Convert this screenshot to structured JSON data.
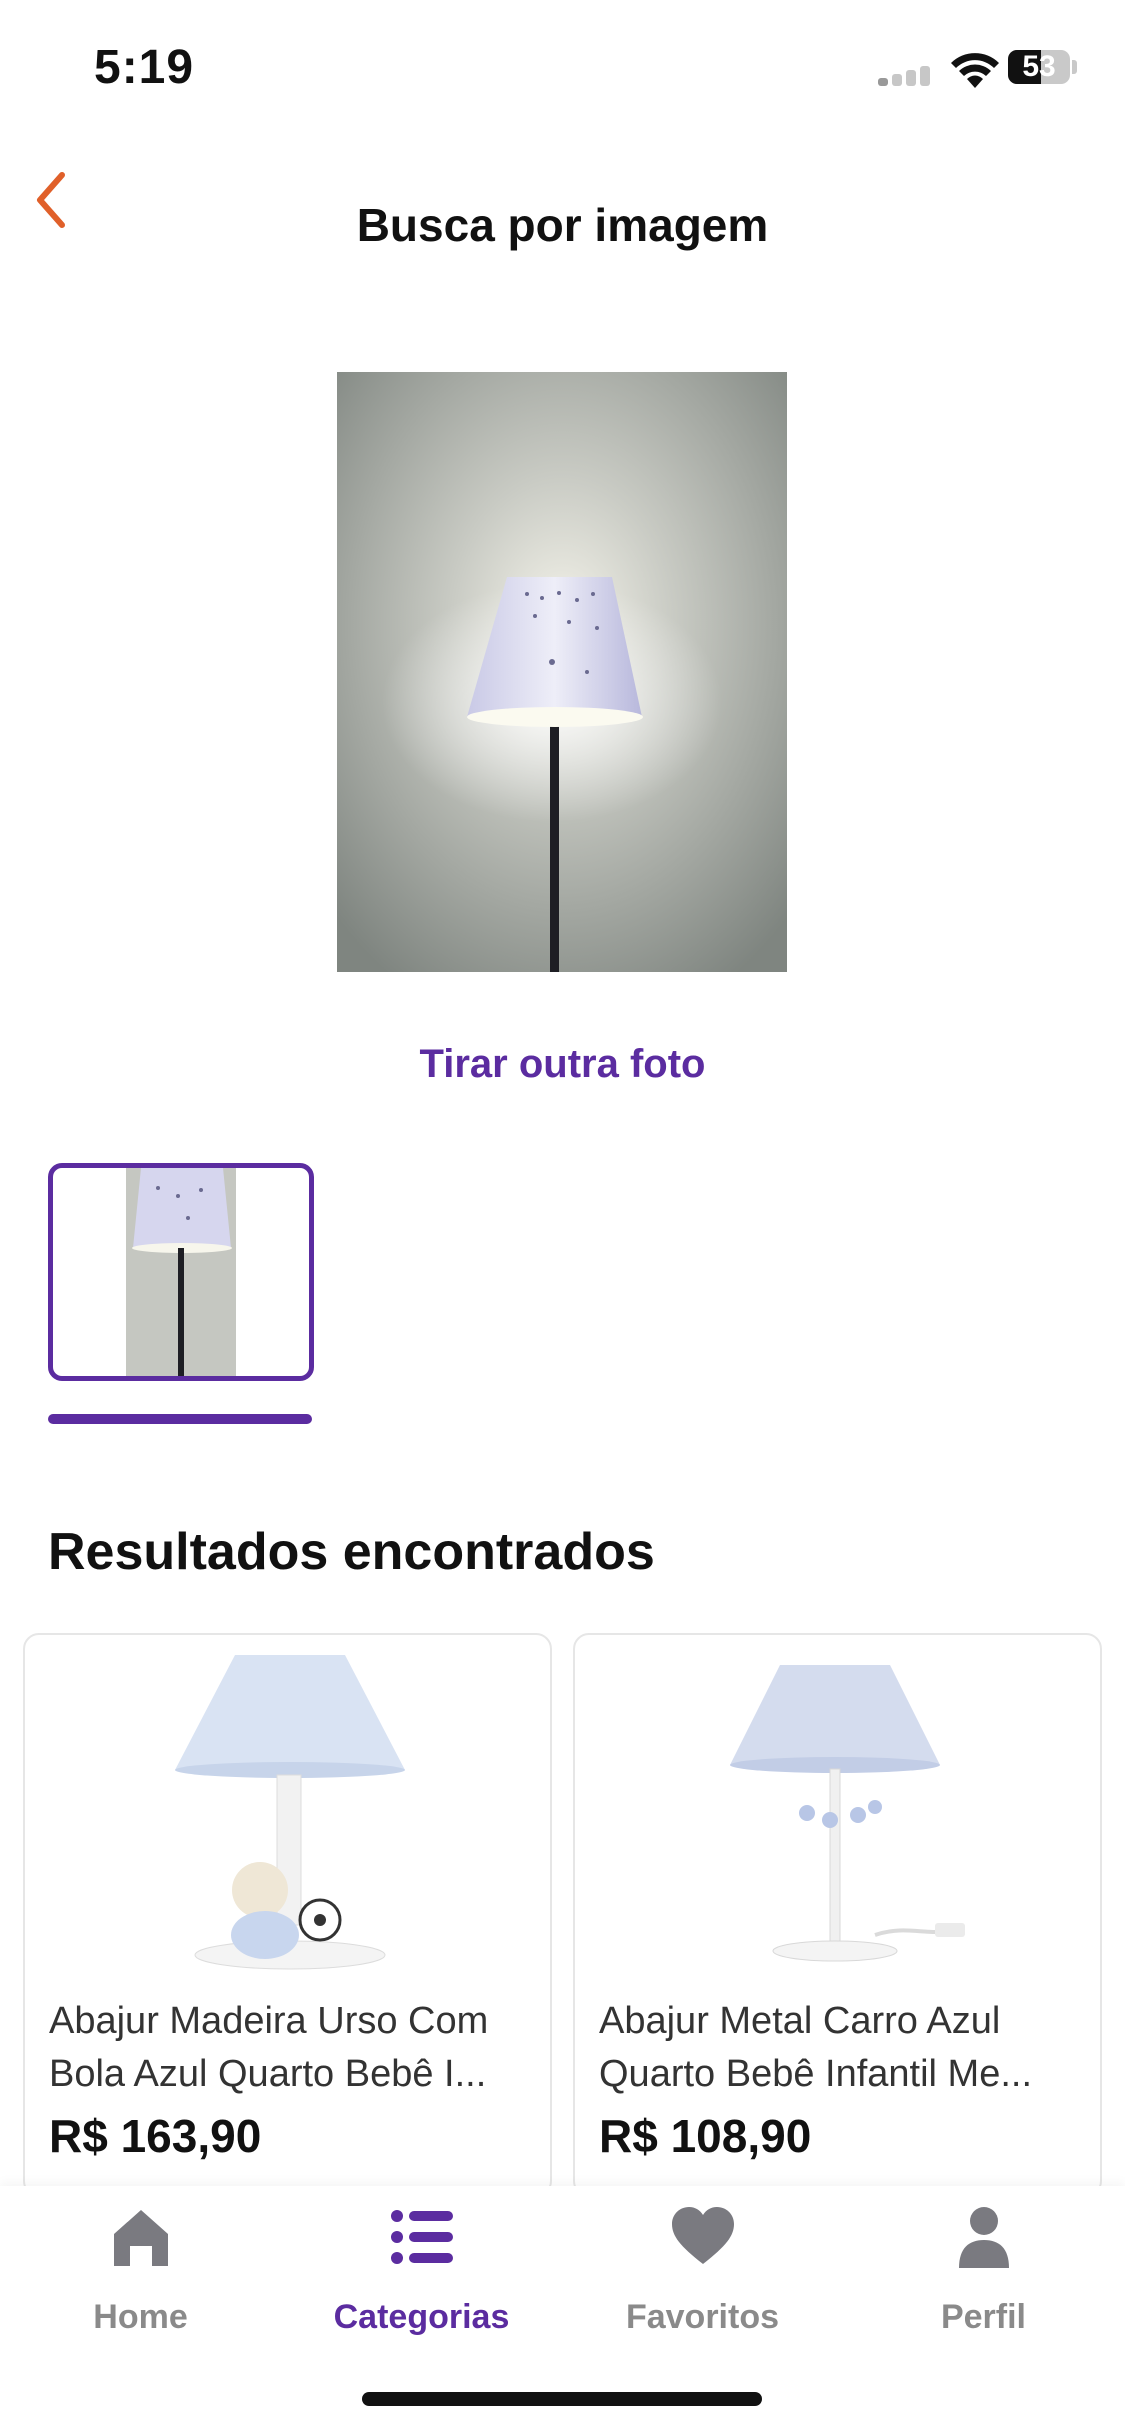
{
  "status_bar": {
    "time": "5:19",
    "battery": "53"
  },
  "header": {
    "title": "Busca por imagem"
  },
  "photo": {
    "retake_label": "Tirar outra foto"
  },
  "results": {
    "title": "Resultados encontrados",
    "products": [
      {
        "name": "Abajur Madeira Urso Com Bola Azul Quarto Bebê I...",
        "price": "R$ 163,90"
      },
      {
        "name": "Abajur Metal Carro Azul Quarto Bebê Infantil Me...",
        "price": "R$ 108,90"
      }
    ]
  },
  "tab_bar": {
    "items": [
      {
        "label": "Home",
        "icon": "home-icon",
        "active": false
      },
      {
        "label": "Categorias",
        "icon": "list-icon",
        "active": true
      },
      {
        "label": "Favoritos",
        "icon": "heart-icon",
        "active": false
      },
      {
        "label": "Perfil",
        "icon": "person-icon",
        "active": false
      }
    ]
  },
  "colors": {
    "accent": "#5b2ca0",
    "back_arrow": "#e0602a",
    "inactive_tab": "#8a8a8a"
  }
}
